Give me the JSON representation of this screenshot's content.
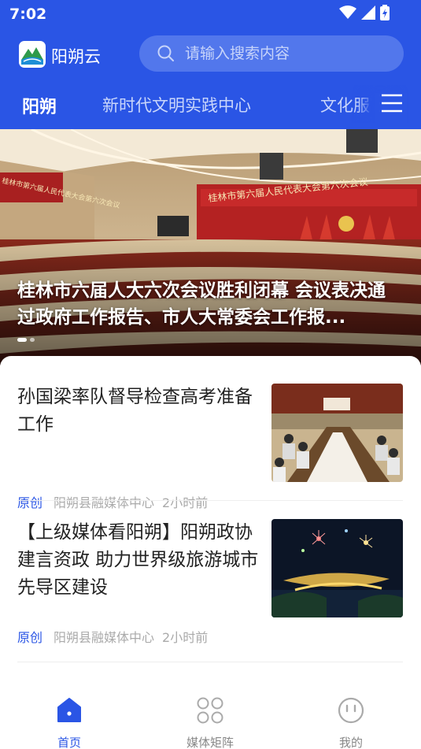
{
  "status_bar": {
    "time": "7:02"
  },
  "app": {
    "name": "阳朔云"
  },
  "search": {
    "placeholder": "请输入搜索内容"
  },
  "tabs": [
    {
      "label": "阳朔",
      "active": true
    },
    {
      "label": "新时代文明实践中心",
      "active": false
    },
    {
      "label": "文化服",
      "active": false
    }
  ],
  "banner": {
    "title": "桂林市六届人大六次会议胜利闭幕 会议表决通过政府工作报告、市人大常委会工作报...",
    "hall_sign_left": "桂林市第六届人民代表大会第六次会议",
    "hall_sign_right": "桂林市第六届人民代表大会第六次会议",
    "slide_index": 1,
    "slide_count": 2
  },
  "news": [
    {
      "title": "孙国梁率队督导检查高考准备工作",
      "tag": "原创",
      "source": "阳朔县融媒体中心",
      "time": "2小时前"
    },
    {
      "title": "【上级媒体看阳朔】阳朔政协建言资政 助力世界级旅游城市先导区建设",
      "tag": "原创",
      "source": "阳朔县融媒体中心",
      "time": "2小时前"
    }
  ],
  "bottom_nav": [
    {
      "label": "首页",
      "icon": "home-icon",
      "active": true
    },
    {
      "label": "媒体矩阵",
      "icon": "grid-icon",
      "active": false
    },
    {
      "label": "我的",
      "icon": "smiley-icon",
      "active": false
    }
  ],
  "colors": {
    "primary": "#2a55e5",
    "meta": "#aaaaaa"
  }
}
